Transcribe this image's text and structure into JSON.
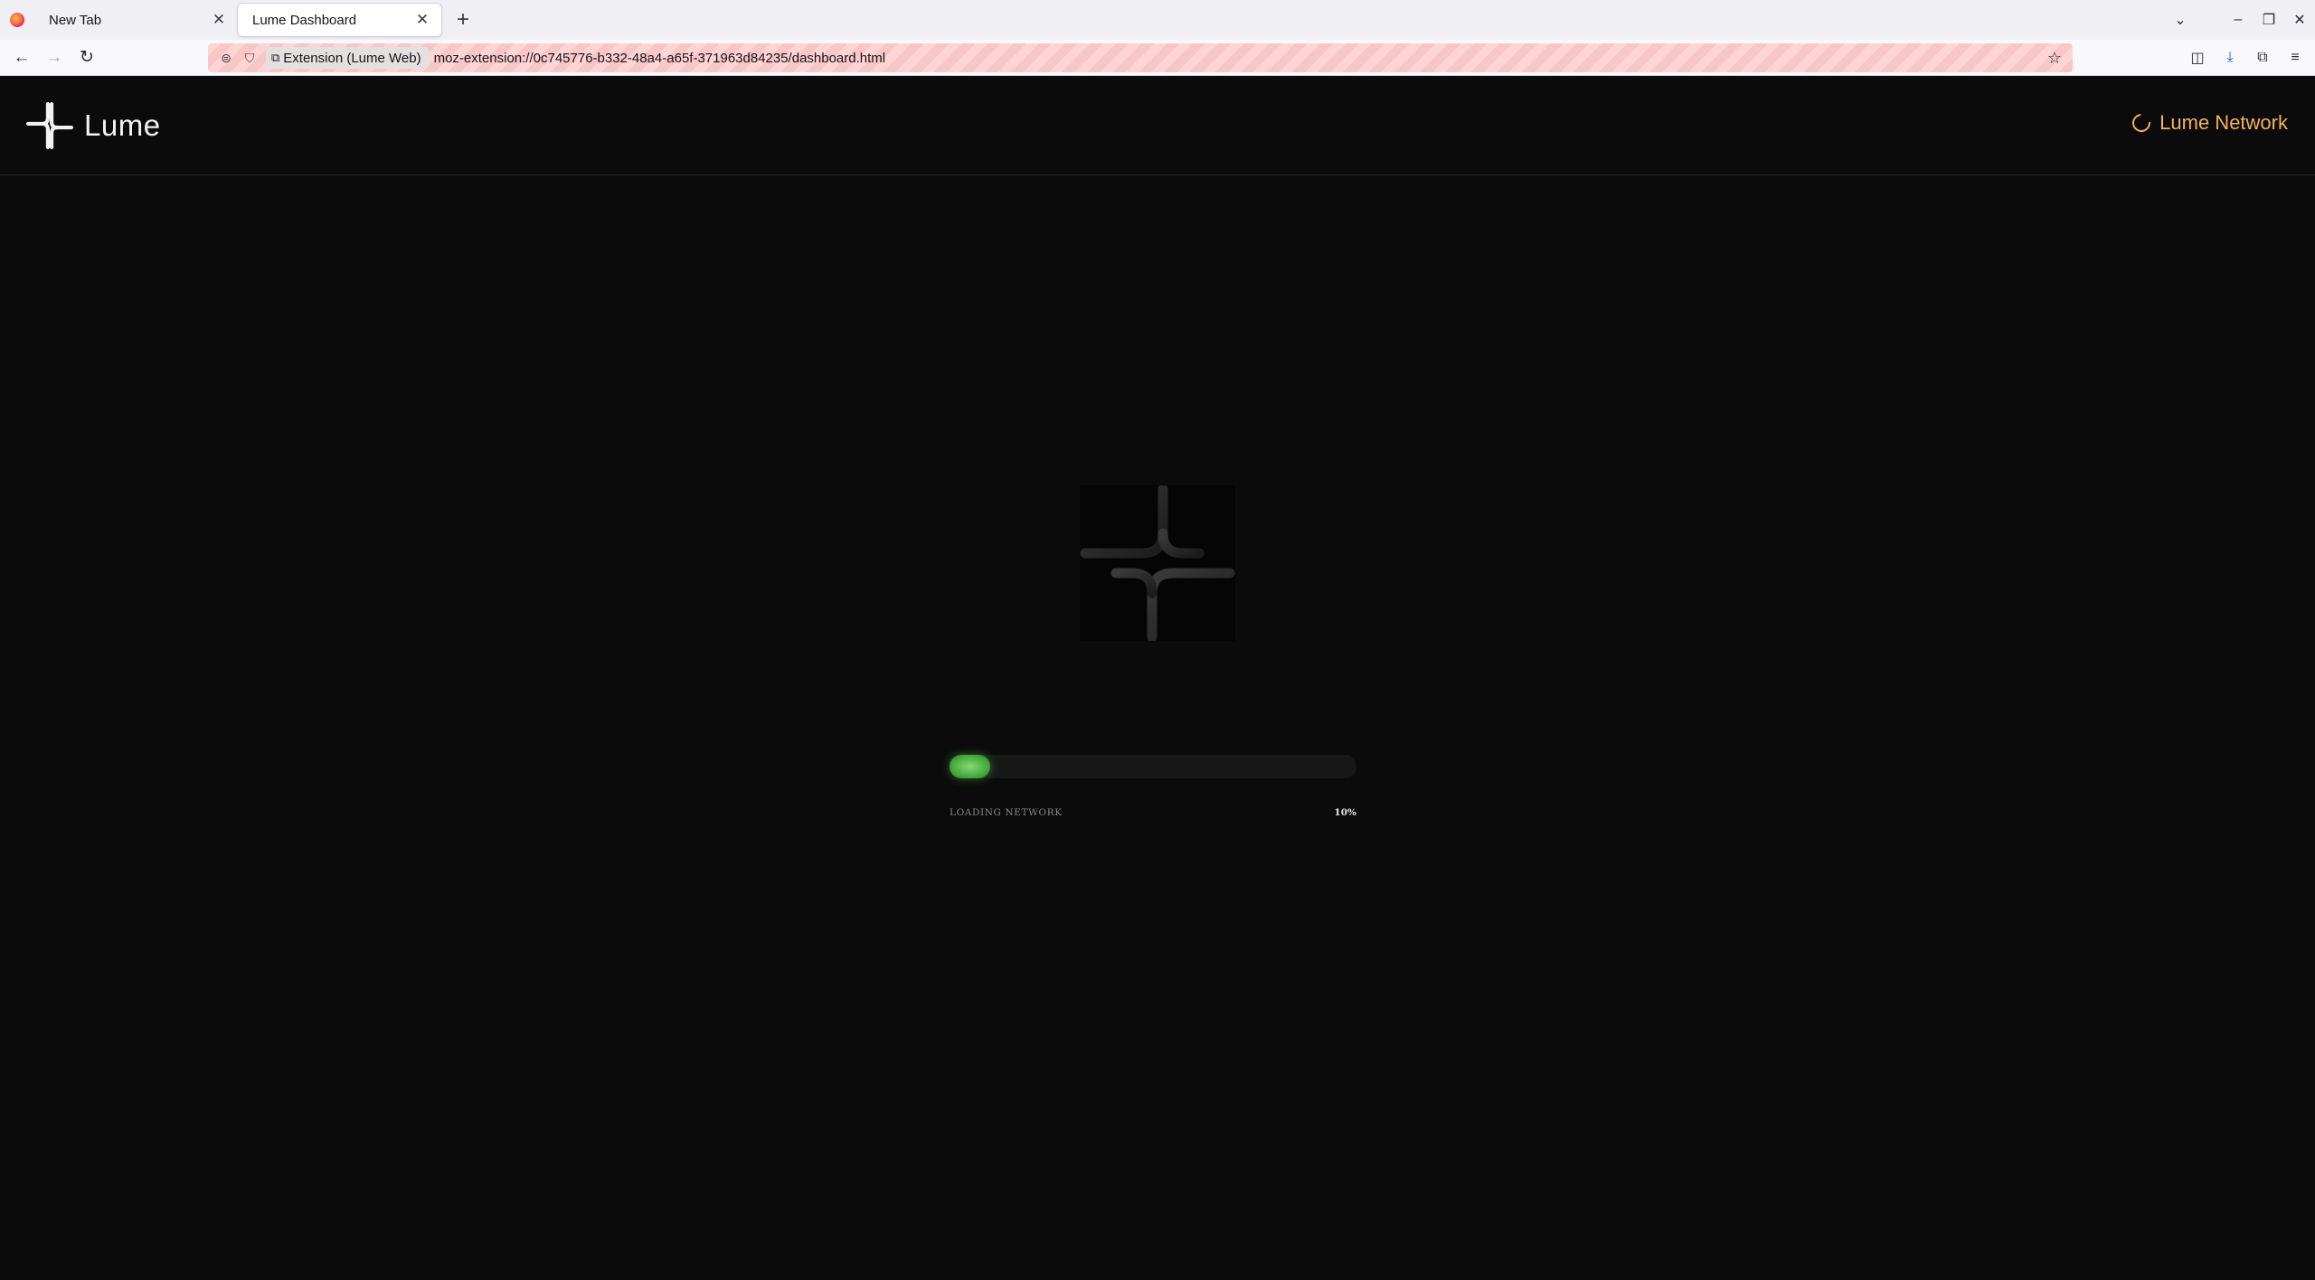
{
  "browser": {
    "tabs": [
      {
        "label": "New Tab",
        "active": false
      },
      {
        "label": "Lume Dashboard",
        "active": true
      }
    ],
    "url_chip": "Extension (Lume Web)",
    "url": "moz-extension://0c745776-b332-48a4-a65f-371963d84235/dashboard.html"
  },
  "header": {
    "logo_text": "Lume",
    "network_status": "Lume Network",
    "status_color": "#f2b35a"
  },
  "loader": {
    "label": "LOADING NETWORK",
    "percent_text": "10%",
    "progress_fraction": 0.1,
    "fill_color": "#4bb040"
  }
}
